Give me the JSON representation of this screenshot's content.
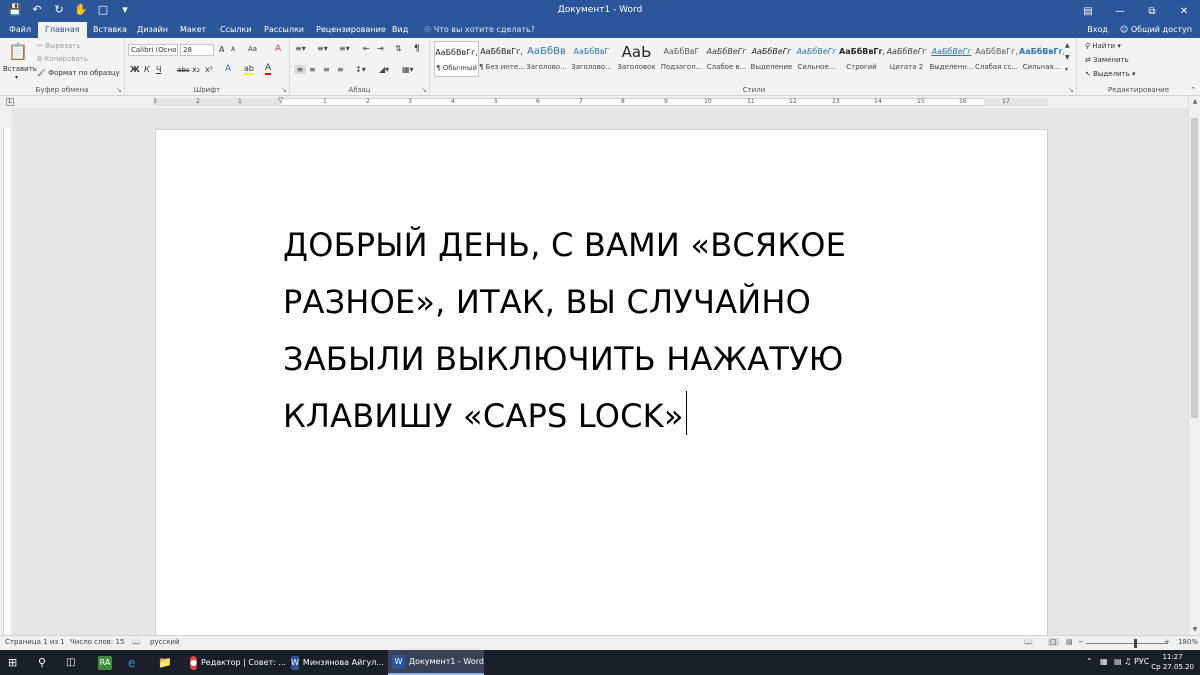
{
  "window": {
    "title": "Документ1 - Word",
    "controls": [
      "ribbon-display",
      "minimize",
      "restore",
      "close"
    ]
  },
  "qat": {
    "icons": [
      "save-icon",
      "undo-icon",
      "redo-icon",
      "touch-mode-icon",
      "new-document-icon",
      "customize-qat-icon"
    ]
  },
  "tabs": [
    {
      "label": "Файл",
      "active": false
    },
    {
      "label": "Главная",
      "active": true
    },
    {
      "label": "Вставка",
      "active": false
    },
    {
      "label": "Дизайн",
      "active": false
    },
    {
      "label": "Макет",
      "active": false
    },
    {
      "label": "Ссылки",
      "active": false
    },
    {
      "label": "Рассылки",
      "active": false
    },
    {
      "label": "Рецензирование",
      "active": false
    },
    {
      "label": "Вид",
      "active": false
    }
  ],
  "tell_me": "Что вы хотите сделать?",
  "account": {
    "signin": "Вход",
    "share": "Общий доступ"
  },
  "clipboard": {
    "label": "Буфер обмена",
    "paste": "Вставить",
    "cut": "Вырезать",
    "copy": "Копировать",
    "format_painter": "Формат по образцу"
  },
  "font": {
    "label": "Шрифт",
    "family": "Calibri (Осно",
    "size": "28",
    "buttons": [
      "Ж",
      "К",
      "Ч",
      "abc",
      "x₂",
      "x²"
    ],
    "grow": "A",
    "shrink": "A",
    "case": "Aa",
    "clear_formatting": "A",
    "text_effects": "A",
    "highlight": "ab",
    "font_color": "A",
    "font_color_hex": "#ff0000",
    "highlight_hex": "#ffff00"
  },
  "paragraph": {
    "label": "Абзац",
    "pilcrow": "¶"
  },
  "styles": {
    "label": "Стили",
    "items": [
      {
        "preview": "АаБбВвГг,",
        "name": "¶ Обычный",
        "selected": true
      },
      {
        "preview": "АаБбВвГг,",
        "name": "¶ Без инте...",
        "selected": false
      },
      {
        "preview": "АаБбВв",
        "name": "Заголово...",
        "selected": false
      },
      {
        "preview": "АаБбВвГ",
        "name": "Заголово...",
        "selected": false
      },
      {
        "preview": "АаЬ",
        "name": "Заголовок",
        "selected": false
      },
      {
        "preview": "АаБбВвГ",
        "name": "Подзагол...",
        "selected": false
      },
      {
        "preview": "АаБбВеГг",
        "name": "Слабое в...",
        "selected": false
      },
      {
        "preview": "АаБбВеГг",
        "name": "Выделение",
        "selected": false
      },
      {
        "preview": "АаБбВеГг",
        "name": "Сильное...",
        "selected": false
      },
      {
        "preview": "АаБбВвГг,",
        "name": "Строгий",
        "selected": false
      },
      {
        "preview": "АаБбВеГг",
        "name": "Цитата 2",
        "selected": false
      },
      {
        "preview": "АаБбВеГг",
        "name": "Выделенн...",
        "selected": false
      },
      {
        "preview": "АаБбВвГг,",
        "name": "Слабая сс...",
        "selected": false
      },
      {
        "preview": "АаБбВвГг,",
        "name": "Сильная...",
        "selected": false
      }
    ]
  },
  "editing": {
    "label": "Редактирование",
    "find": "Найти",
    "replace": "Заменить",
    "select": "Выделить"
  },
  "ruler": {
    "numbers": [
      "3",
      "2",
      "1",
      "1",
      "2",
      "3",
      "4",
      "5",
      "6",
      "7",
      "8",
      "9",
      "10",
      "11",
      "12",
      "13",
      "14",
      "15",
      "16",
      "17"
    ]
  },
  "document": {
    "lines": [
      "ДОБРЫЙ ДЕНЬ, С ВАМИ «ВСЯКОЕ",
      "РАЗНОЕ», ИТАК, ВЫ СЛУЧАЙНО",
      "ЗАБЫЛИ ВЫКЛЮЧИТЬ НАЖАТУЮ",
      "КЛАВИШУ «CAPS LOCK»"
    ]
  },
  "status": {
    "page": "Страница 1 из 1",
    "words": "Число слов: 15",
    "language": "русский",
    "zoom": "180%",
    "zoom_value": 180
  },
  "taskbar": {
    "apps": [
      {
        "label": "Редактор | Совет: ...",
        "icon": "chrome-icon",
        "active": false
      },
      {
        "label": "Минзянова Айгул...",
        "icon": "word-icon",
        "active": false
      },
      {
        "label": "Документ1 - Word",
        "icon": "word-icon",
        "active": true
      }
    ],
    "lang": "РУС",
    "time": "11:27",
    "date": "Ср 27.05.20"
  }
}
